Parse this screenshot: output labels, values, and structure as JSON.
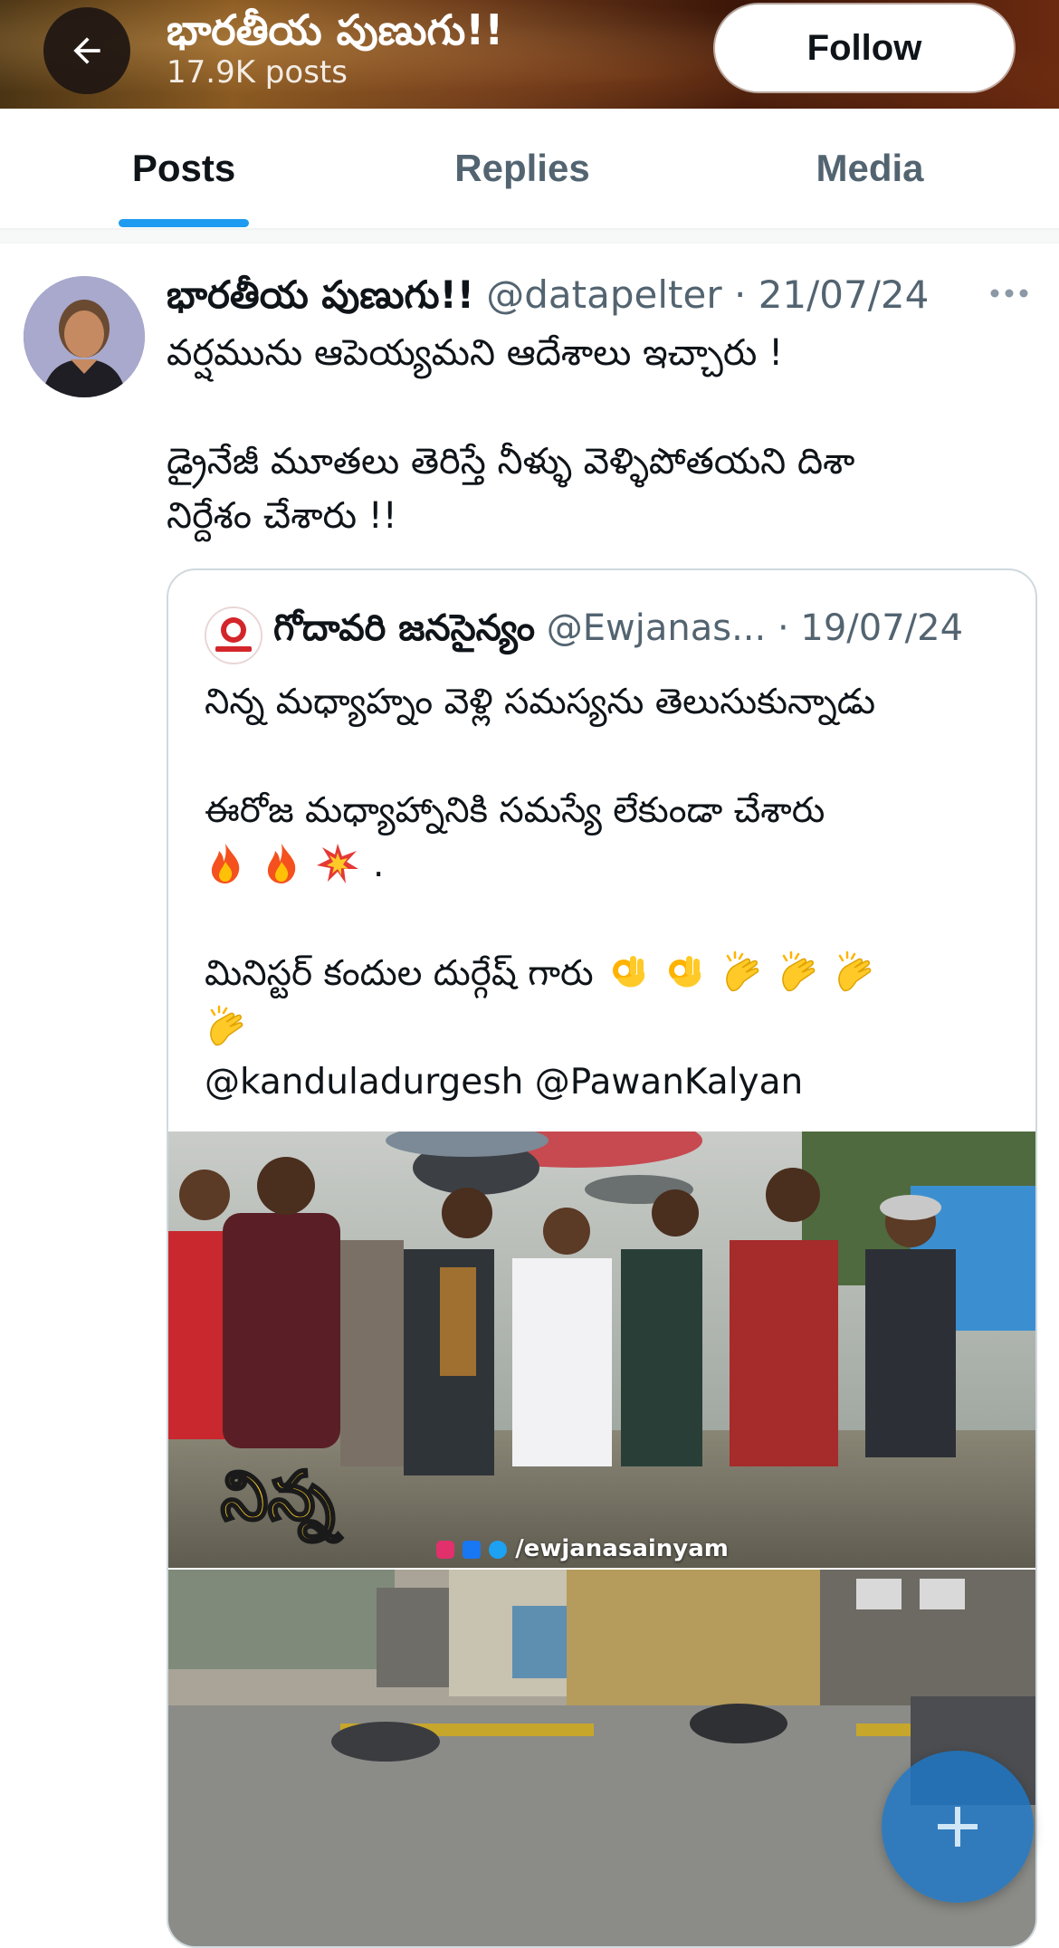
{
  "header": {
    "title": "భారతీయ పుణుగు!!",
    "posts_count": "17.9K posts",
    "follow_label": "Follow"
  },
  "tabs": [
    {
      "label": "Posts",
      "active": true
    },
    {
      "label": "Replies",
      "active": false
    },
    {
      "label": "Media",
      "active": false
    }
  ],
  "tweet": {
    "name": "భారతీయ పుణుగు!!",
    "handle": "@datapelter",
    "separator": "·",
    "date": "21/07/24",
    "lines": [
      "వర్షమును ఆపెయ్యమని ఆదేశాలు ఇచ్చారు !",
      "డ్రైనేజీ మూతలు తెరిస్తే నీళ్ళు వెళ్ళిపోతయని దిశా",
      "నిర్దేశం చేశారు !!"
    ]
  },
  "quote": {
    "name": "గోదావరి జనసైన్యం",
    "handle": "@Ewjanas...",
    "separator": "·",
    "date": "19/07/24",
    "line1": "నిన్న మధ్యాహ్నం వెళ్లి సమస్యను తెలుసుకున్నాడు",
    "line2": "ఈరోజ మధ్యాహ్నానికి సమస్యే లేకుండా చేశారు",
    "line3_suffix": ".",
    "line4": "మినిస్టర్ కందుల దుర్గేష్ గారు",
    "mentions": "@kanduladurgesh @PawanKalyan",
    "media_caption": "నిన్న",
    "media_watermark": "/ewjanasainyam"
  },
  "icons": {
    "back": "arrow-left-icon",
    "more": "more-horizontal-icon",
    "fab": "plus-icon"
  },
  "colors": {
    "accent": "#1d9bf0",
    "text_primary": "#0f1419",
    "text_secondary": "#536471"
  }
}
